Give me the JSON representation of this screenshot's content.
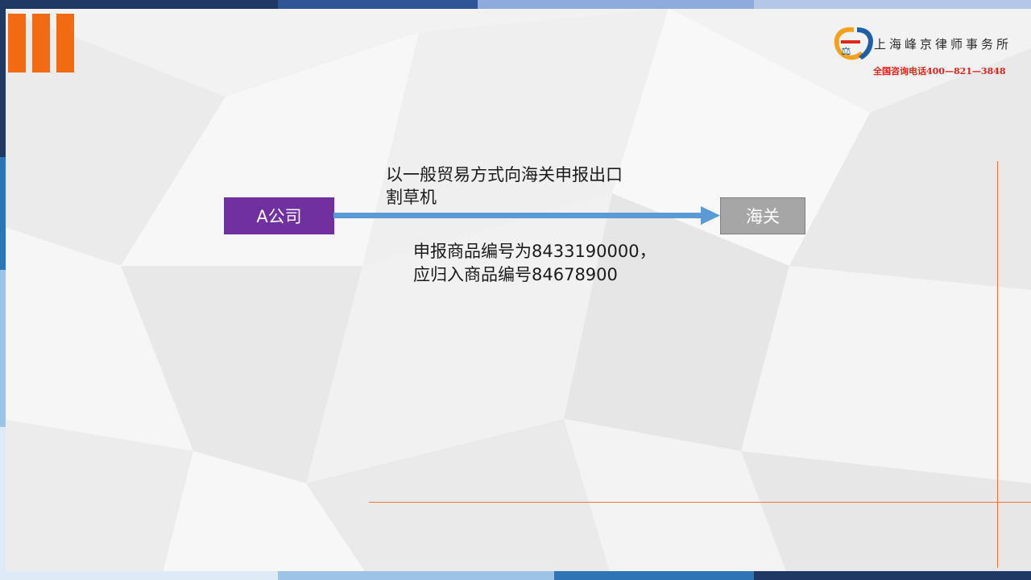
{
  "logo": {
    "firm_name": "上海峰京律师事务所",
    "hotline": "全国咨询电话400—821—3848"
  },
  "diagram": {
    "source_box": "A公司",
    "target_box": "海关",
    "arrow_label_lines": [
      "以一般贸易方式向海关申报出口",
      "割草机"
    ],
    "note_lines": [
      "申报商品编号为8433190000，",
      "应归入商品编号84678900"
    ]
  },
  "colors": {
    "accent_orange": "#f26a11",
    "source_box": "#7030a0",
    "target_box": "#a6a6a6",
    "arrow": "#5b9bd5",
    "hotline": "#e0261b"
  }
}
